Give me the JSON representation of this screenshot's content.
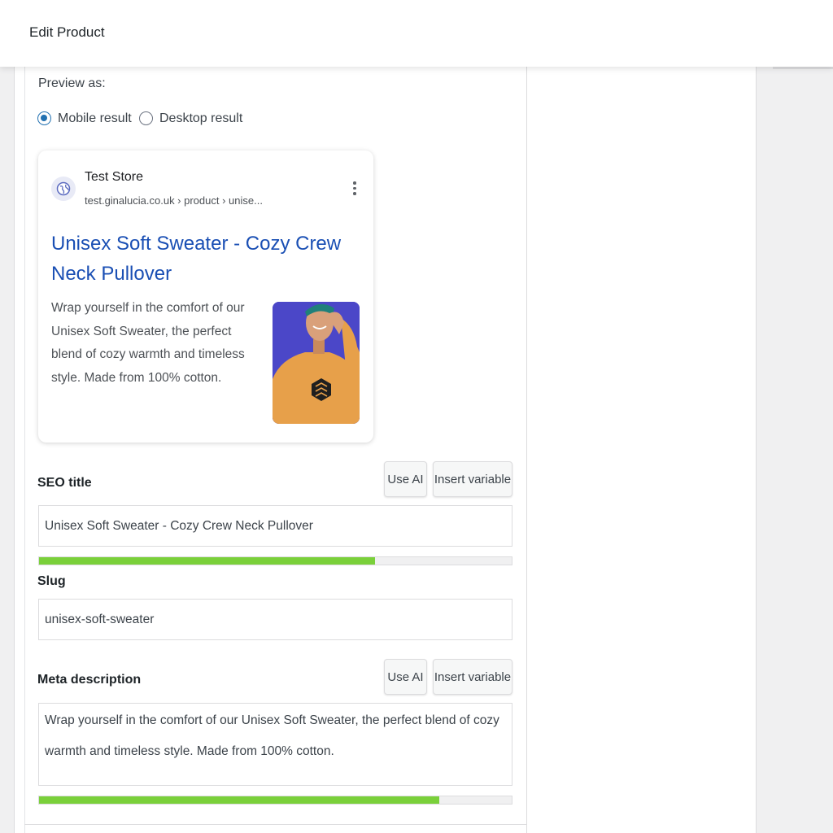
{
  "header": {
    "title": "Edit Product"
  },
  "preview": {
    "label": "Preview as:",
    "options": [
      {
        "label": "Mobile result",
        "selected": true
      },
      {
        "label": "Desktop result",
        "selected": false
      }
    ]
  },
  "serp": {
    "store_name": "Test Store",
    "breadcrumb": "test.ginalucia.co.uk › product › unise...",
    "title": "Unisex Soft Sweater - Cozy Crew Neck Pullover",
    "description": "Wrap yourself in the comfort of our Unisex Soft Sweater, the perfect blend of cozy warmth and timeless style. Made from 100% cotton.",
    "title_color": "#1a4fb4"
  },
  "seo_title": {
    "label": "SEO title",
    "use_ai_label": "Use AI",
    "insert_variable_label": "Insert variable",
    "value": "Unisex Soft Sweater - Cozy Crew Neck Pullover",
    "progress": 0.71,
    "progress_color": "#7ad03a"
  },
  "slug": {
    "label": "Slug",
    "value": "unisex-soft-sweater"
  },
  "meta_description": {
    "label": "Meta description",
    "use_ai_label": "Use AI",
    "insert_variable_label": "Insert variable",
    "value": "Wrap yourself in the comfort of our Unisex Soft Sweater, the perfect blend of cozy warmth and timeless style. Made from 100% cotton.",
    "progress": 0.847,
    "progress_color": "#7ad03a"
  }
}
